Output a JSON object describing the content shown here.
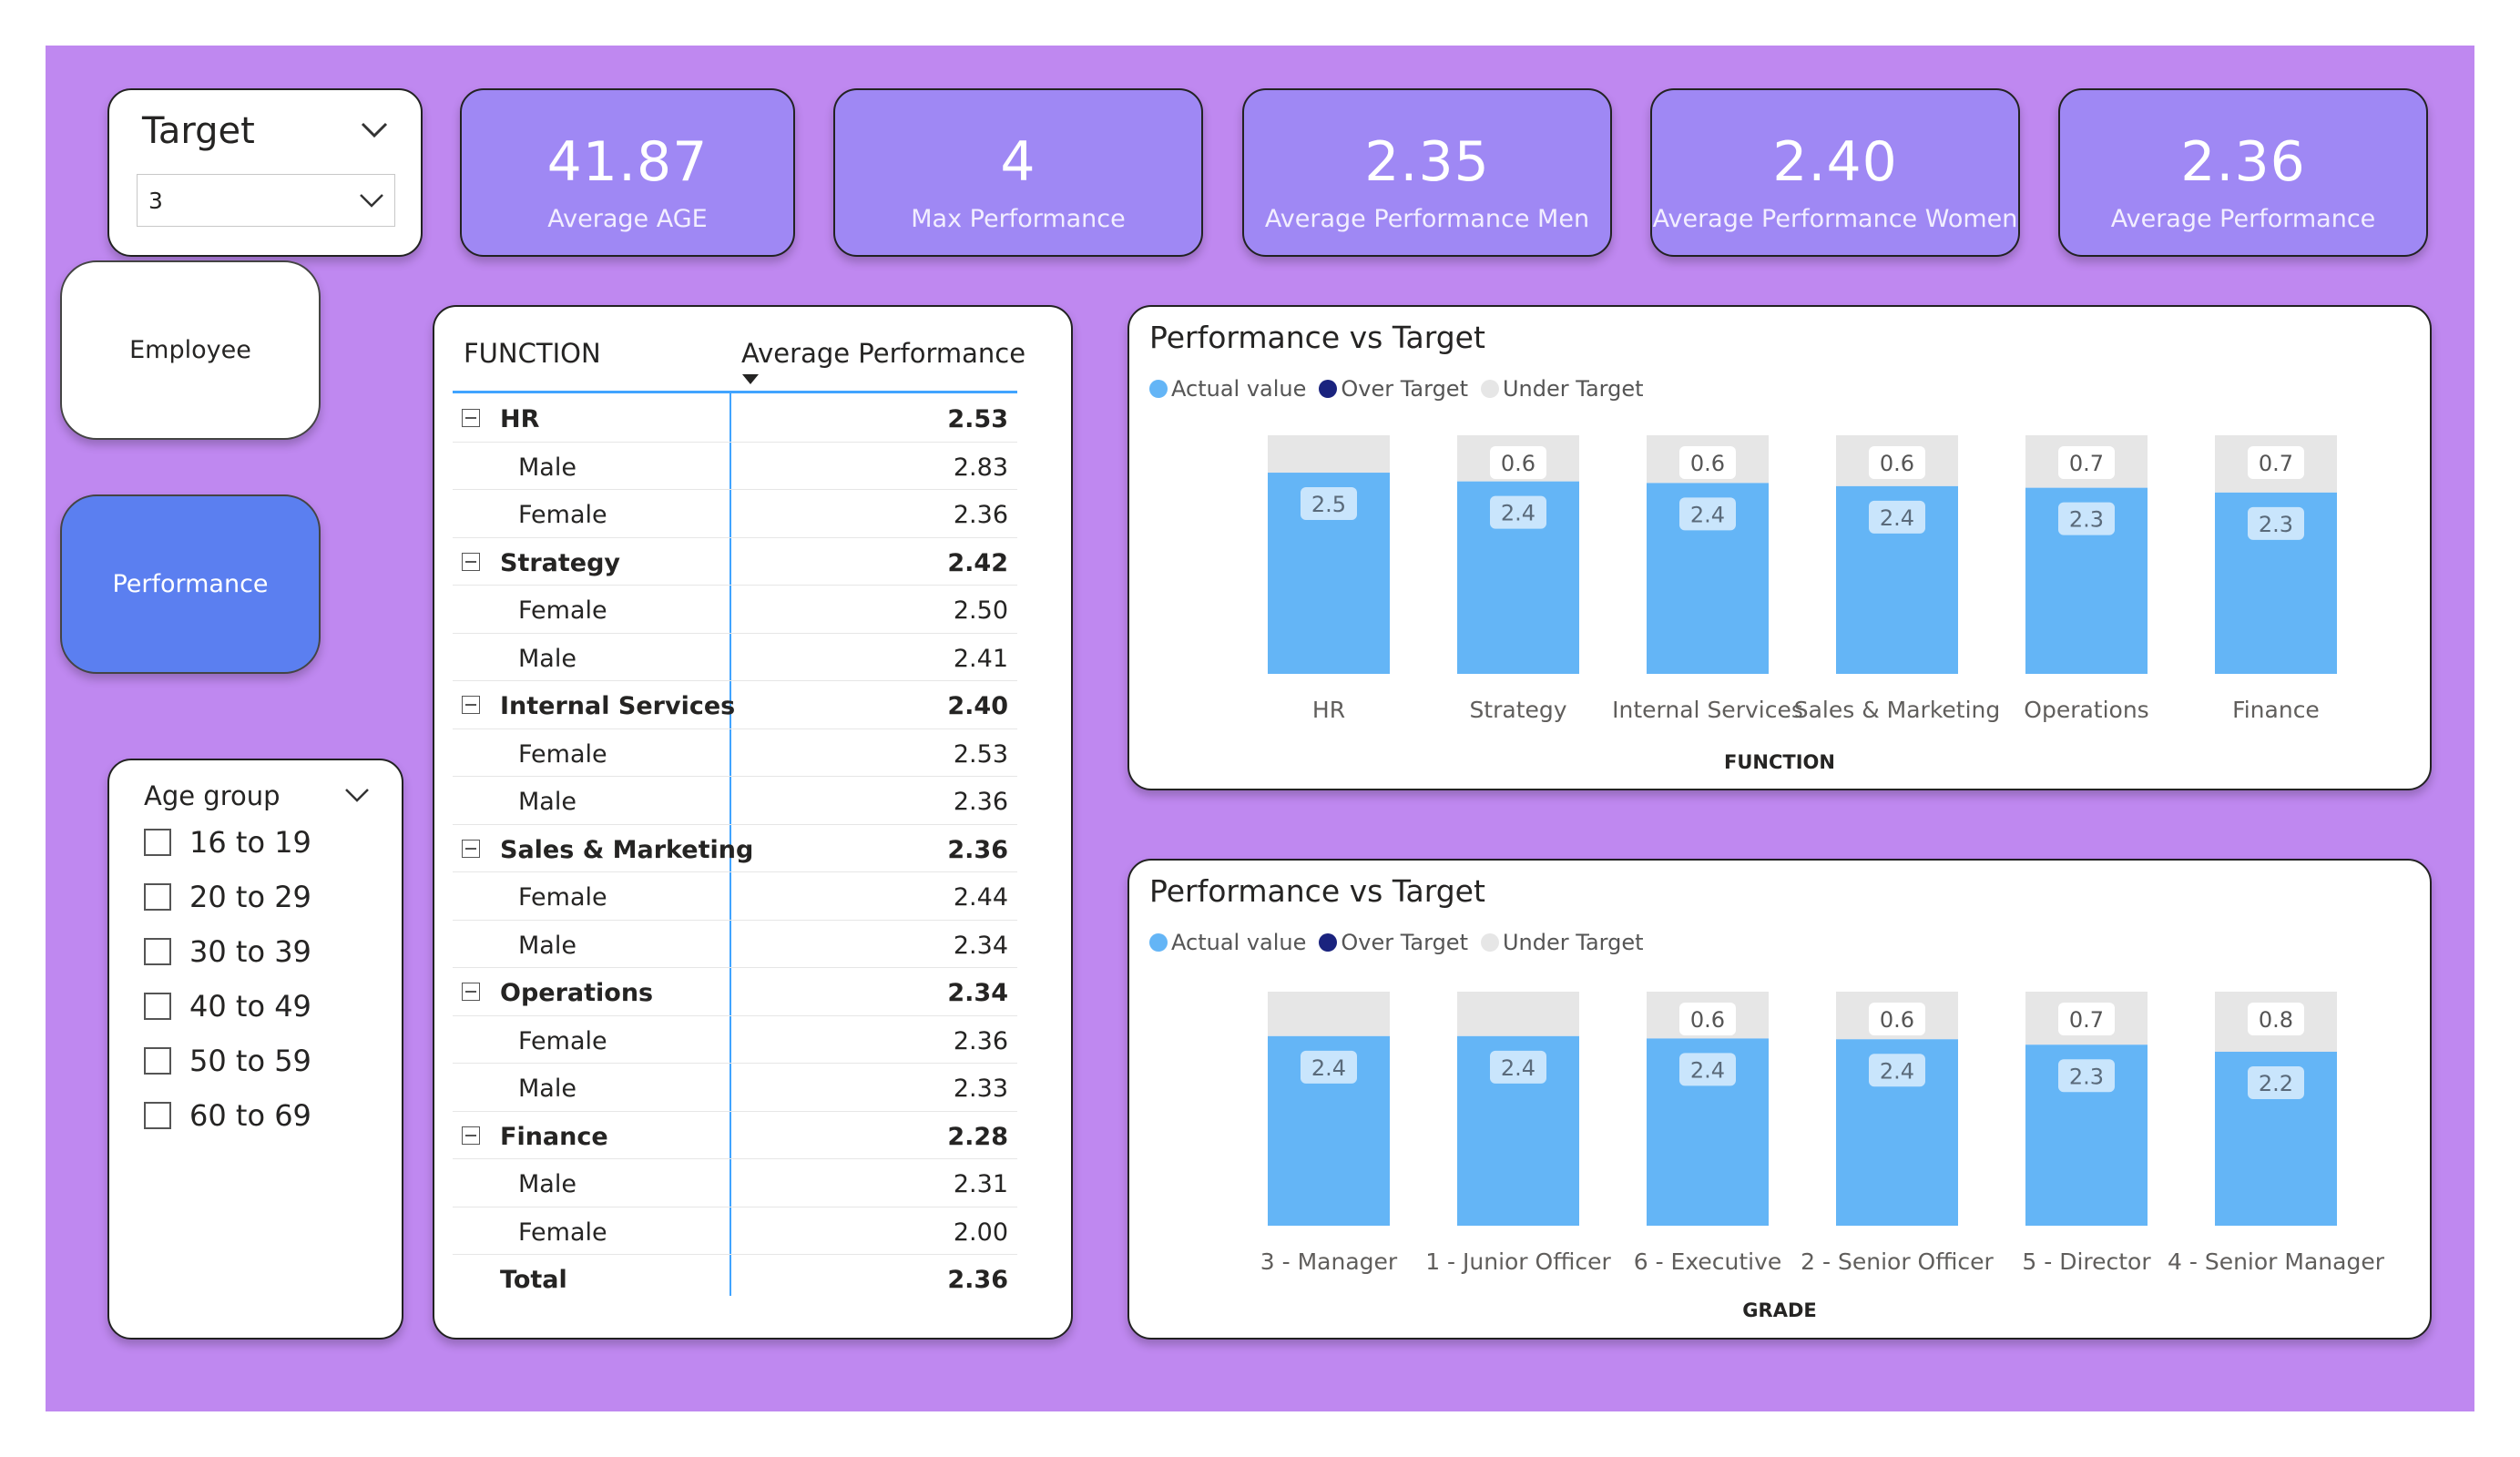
{
  "colors": {
    "canvas": "#bf88f0",
    "kpi_card": "#9f88f4",
    "active_button": "#5b7ff0",
    "actual_value": "#64b5f6",
    "over_target": "#1a237e",
    "under_target": "#e6e6e6",
    "table_accent": "#41a4ff"
  },
  "target_slicer": {
    "title": "Target",
    "selected": "3",
    "icon": "chevron-down-icon"
  },
  "kpis": [
    {
      "value": "41.87",
      "label": "Average AGE"
    },
    {
      "value": "4",
      "label": "Max Performance"
    },
    {
      "value": "2.35",
      "label": "Average Performance Men"
    },
    {
      "value": "2.40",
      "label": "Average Performance Women"
    },
    {
      "value": "2.36",
      "label": "Average Performance"
    }
  ],
  "nav": {
    "employee": "Employee",
    "performance": "Performance",
    "active": "Performance"
  },
  "age_group": {
    "title": "Age group",
    "items": [
      "16 to 19",
      "20 to 29",
      "30 to 39",
      "40 to 49",
      "50 to 59",
      "60 to 69"
    ]
  },
  "matrix": {
    "col1": "FUNCTION",
    "col2": "Average Performance",
    "sort": "descending",
    "rows": [
      {
        "type": "group",
        "name": "HR",
        "value": "2.53"
      },
      {
        "type": "child",
        "name": "Male",
        "value": "2.83"
      },
      {
        "type": "child",
        "name": "Female",
        "value": "2.36"
      },
      {
        "type": "group",
        "name": "Strategy",
        "value": "2.42"
      },
      {
        "type": "child",
        "name": "Female",
        "value": "2.50"
      },
      {
        "type": "child",
        "name": "Male",
        "value": "2.41"
      },
      {
        "type": "group",
        "name": "Internal Services",
        "value": "2.40"
      },
      {
        "type": "child",
        "name": "Female",
        "value": "2.53"
      },
      {
        "type": "child",
        "name": "Male",
        "value": "2.36"
      },
      {
        "type": "group",
        "name": "Sales & Marketing",
        "value": "2.36"
      },
      {
        "type": "child",
        "name": "Female",
        "value": "2.44"
      },
      {
        "type": "child",
        "name": "Male",
        "value": "2.34"
      },
      {
        "type": "group",
        "name": "Operations",
        "value": "2.34"
      },
      {
        "type": "child",
        "name": "Female",
        "value": "2.36"
      },
      {
        "type": "child",
        "name": "Male",
        "value": "2.33"
      },
      {
        "type": "group",
        "name": "Finance",
        "value": "2.28"
      },
      {
        "type": "child",
        "name": "Male",
        "value": "2.31"
      },
      {
        "type": "child",
        "name": "Female",
        "value": "2.00"
      },
      {
        "type": "total",
        "name": "Total",
        "value": "2.36"
      }
    ]
  },
  "chart_data": [
    {
      "type": "bar",
      "stacked": true,
      "title": "Performance vs Target",
      "xlabel": "FUNCTION",
      "legend": [
        "Actual value",
        "Over Target",
        "Under Target"
      ],
      "legend_position": "top-left",
      "target": 3,
      "categories": [
        "HR",
        "Strategy",
        "Internal Services",
        "Sales & Marketing",
        "Operations",
        "Finance"
      ],
      "series": [
        {
          "name": "Actual value",
          "values": [
            2.53,
            2.42,
            2.4,
            2.36,
            2.34,
            2.28
          ],
          "labels": [
            "2.5",
            "2.4",
            "2.4",
            "2.4",
            "2.3",
            "2.3"
          ]
        },
        {
          "name": "Under Target",
          "values": [
            0.47,
            0.58,
            0.6,
            0.64,
            0.66,
            0.72
          ],
          "labels": [
            "",
            "0.6",
            "0.6",
            "0.6",
            "0.7",
            "0.7"
          ]
        }
      ]
    },
    {
      "type": "bar",
      "stacked": true,
      "title": "Performance vs Target",
      "xlabel": "GRADE",
      "legend": [
        "Actual value",
        "Over Target",
        "Under Target"
      ],
      "legend_position": "top-left",
      "target": 3,
      "categories": [
        "3 - Manager",
        "1 - Junior Officer",
        "6 - Executive",
        "2 - Senior Officer",
        "5 - Director",
        "4 - Senior Manager"
      ],
      "series": [
        {
          "name": "Actual value",
          "values": [
            2.43,
            2.43,
            2.4,
            2.39,
            2.32,
            2.23
          ],
          "labels": [
            "2.4",
            "2.4",
            "2.4",
            "2.4",
            "2.3",
            "2.2"
          ]
        },
        {
          "name": "Under Target",
          "values": [
            0.57,
            0.57,
            0.6,
            0.61,
            0.68,
            0.77
          ],
          "labels": [
            "",
            "",
            "0.6",
            "0.6",
            "0.7",
            "0.8"
          ]
        }
      ]
    }
  ]
}
